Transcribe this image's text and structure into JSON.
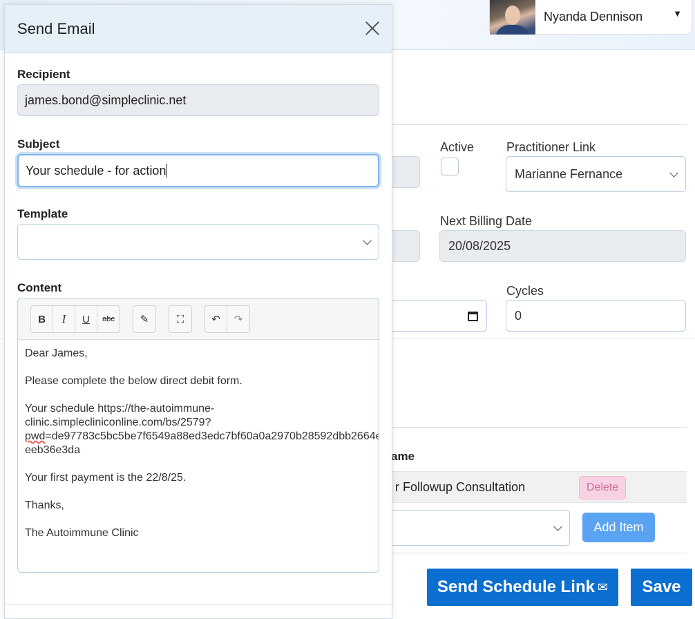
{
  "header": {
    "user_name": "Nyanda Dennison"
  },
  "form": {
    "active_label": "Active",
    "practitioner_link_label": "Practitioner Link",
    "practitioner_link_value": "Marianne Fernance",
    "next_billing_date_label": "Next Billing Date",
    "next_billing_date_value": "20/08/2025",
    "cycles_label": "Cycles",
    "cycles_value": "0"
  },
  "items_table": {
    "name_header": "ame",
    "row_item": "r Followup Consultation",
    "delete_label": "Delete",
    "add_item_label": "Add Item"
  },
  "actions": {
    "send_schedule_link_label": "Send Schedule Link",
    "save_label": "Save"
  },
  "modal": {
    "title": "Send Email",
    "recipient_label": "Recipient",
    "recipient_value": "james.bond@simpleclinic.net",
    "subject_label": "Subject",
    "subject_value": "Your schedule - for action",
    "template_label": "Template",
    "template_value": "",
    "content_label": "Content",
    "toolbar": {
      "bold": "B",
      "italic": "I",
      "underline": "U",
      "strikethrough": "abc"
    },
    "content": {
      "greeting": "Dear James,",
      "line1": "Please complete the below direct debit form.",
      "schedule_prefix": "Your schedule https://the-autoimmune-",
      "schedule_mid": "clinic.simplecliniconline.com/bs/2579?",
      "schedule_pwd": "pwd",
      "schedule_rest": "=de97783c5bc5be7f6549a88ed3edc7bf60a0a2970b28592dbb2664e",
      "schedule_end": "eeb36e3da",
      "first_payment": "Your first payment is the 22/8/25.",
      "thanks": "Thanks,",
      "signature": "The Autoimmune Clinic"
    }
  }
}
